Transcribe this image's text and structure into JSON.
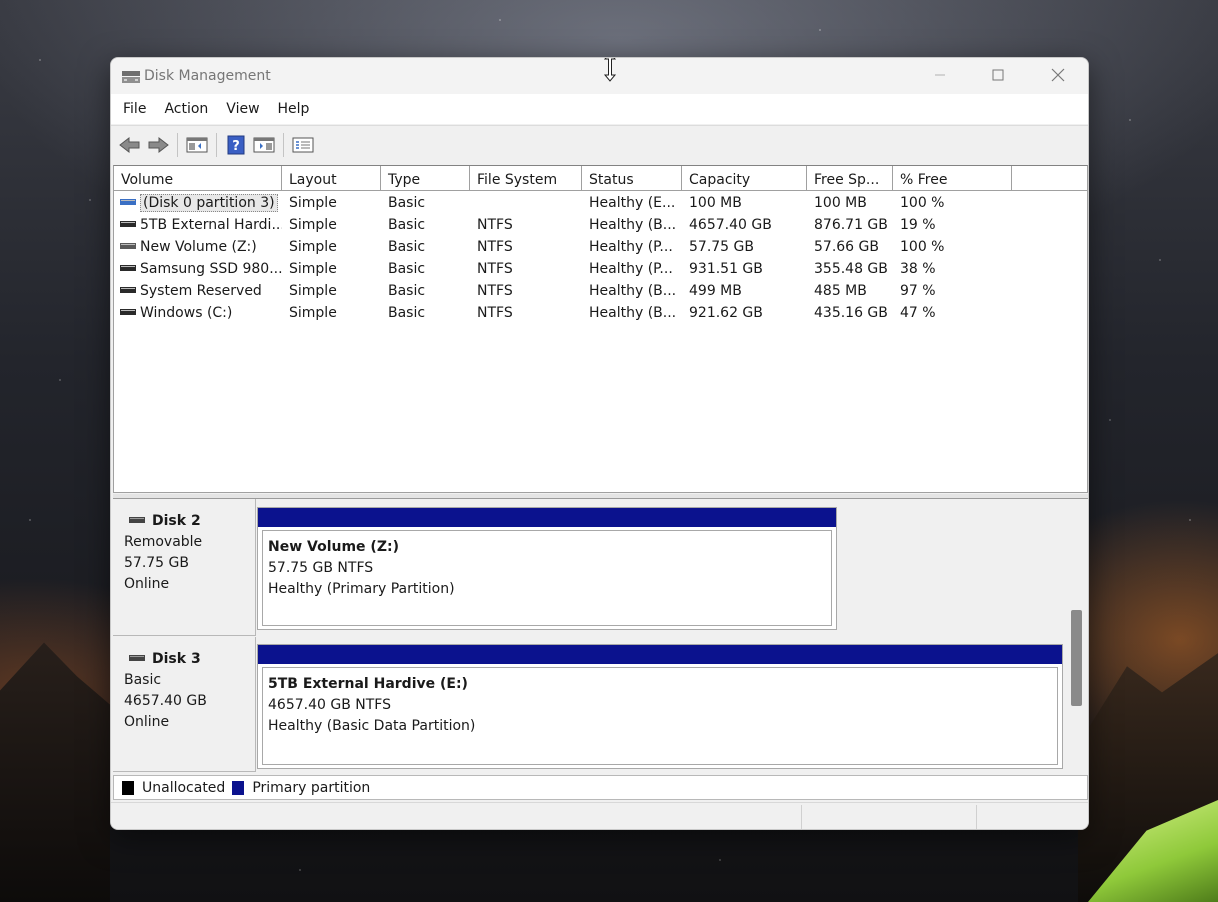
{
  "window": {
    "title": "Disk Management"
  },
  "menu": {
    "items": [
      "File",
      "Action",
      "View",
      "Help"
    ]
  },
  "toolbar": {
    "buttons": [
      {
        "icon": "back-arrow-icon"
      },
      {
        "icon": "forward-arrow-icon"
      },
      {
        "icon": "show-hide-console-tree-icon"
      },
      {
        "icon": "help-icon"
      },
      {
        "icon": "properties-icon"
      },
      {
        "icon": "list-view-icon"
      }
    ]
  },
  "volume_list": {
    "columns": [
      "Volume",
      "Layout",
      "Type",
      "File System",
      "Status",
      "Capacity",
      "Free Sp...",
      "% Free"
    ],
    "rows": [
      {
        "volume": "(Disk 0 partition 3)",
        "layout": "Simple",
        "type": "Basic",
        "fs": "",
        "status": "Healthy (E...",
        "capacity": "100 MB",
        "free": "100 MB",
        "pct": "100 %",
        "icon_color": "#3a6fc4",
        "selected": true
      },
      {
        "volume": "5TB External Hardi...",
        "layout": "Simple",
        "type": "Basic",
        "fs": "NTFS",
        "status": "Healthy (B...",
        "capacity": "4657.40 GB",
        "free": "876.71 GB",
        "pct": "19 %",
        "icon_color": "#2a2a2a"
      },
      {
        "volume": "New Volume (Z:)",
        "layout": "Simple",
        "type": "Basic",
        "fs": "NTFS",
        "status": "Healthy (P...",
        "capacity": "57.75 GB",
        "free": "57.66 GB",
        "pct": "100 %",
        "icon_color": "#5a5a5a"
      },
      {
        "volume": "Samsung SSD 980...",
        "layout": "Simple",
        "type": "Basic",
        "fs": "NTFS",
        "status": "Healthy (P...",
        "capacity": "931.51 GB",
        "free": "355.48 GB",
        "pct": "38 %",
        "icon_color": "#2a2a2a"
      },
      {
        "volume": "System Reserved",
        "layout": "Simple",
        "type": "Basic",
        "fs": "NTFS",
        "status": "Healthy (B...",
        "capacity": "499 MB",
        "free": "485 MB",
        "pct": "97 %",
        "icon_color": "#2a2a2a"
      },
      {
        "volume": "Windows (C:)",
        "layout": "Simple",
        "type": "Basic",
        "fs": "NTFS",
        "status": "Healthy (B...",
        "capacity": "921.62 GB",
        "free": "435.16 GB",
        "pct": "47 %",
        "icon_color": "#2a2a2a"
      }
    ]
  },
  "disks": [
    {
      "name": "Disk 2",
      "kind": "Removable",
      "size": "57.75 GB",
      "state": "Online",
      "partition": {
        "title": "New Volume  (Z:)",
        "size_fs": "57.75 GB NTFS",
        "status": "Healthy (Primary Partition)"
      }
    },
    {
      "name": "Disk 3",
      "kind": "Basic",
      "size": "4657.40 GB",
      "state": "Online",
      "partition": {
        "title": "5TB External Hardive  (E:)",
        "size_fs": "4657.40 GB NTFS",
        "status": "Healthy (Basic Data Partition)"
      }
    }
  ],
  "legend": {
    "items": [
      {
        "label": "Unallocated",
        "color": "#000000"
      },
      {
        "label": "Primary partition",
        "color": "#0b128e"
      }
    ]
  },
  "colors": {
    "primary_partition": "#0b128e"
  }
}
